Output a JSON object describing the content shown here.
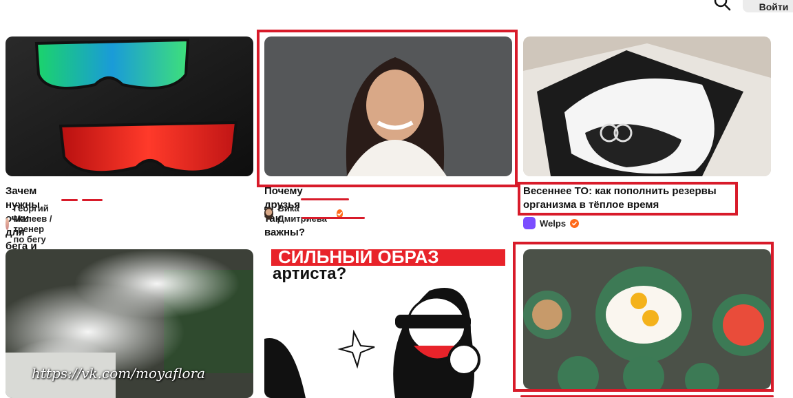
{
  "header": {
    "login_label": "Войти"
  },
  "cards": [
    {
      "title": "Зачем нужны очки для бега и вела?",
      "author": "Георгий Малеев / тренер по бегу",
      "verified": false
    },
    {
      "title": "Почему друзья так важны?",
      "author": "Вика Дмитриева",
      "verified": true
    },
    {
      "title": "Весеннее ТО: как пополнить резервы организма в тёплое время",
      "author": "Welps",
      "verified": true
    },
    {
      "image_text": "https://vk.com/moyaflora"
    },
    {
      "image_text_line1": "СИЛЬНЫЙ ОБРАЗ",
      "image_text_line2": "артиста?"
    },
    {}
  ],
  "colors": {
    "annotation": "#d81b2a",
    "verified": "#ff6a1a"
  },
  "icons": [
    "search-icon",
    "verified-icon"
  ]
}
